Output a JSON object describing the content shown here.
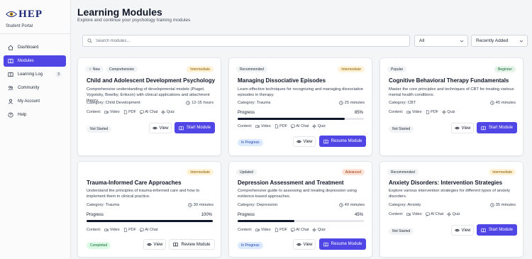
{
  "sidebar": {
    "logo_text": "HEP",
    "portal_label": "Student Portal",
    "items": [
      {
        "label": "Dashboard",
        "icon": "home-icon"
      },
      {
        "label": "Modules",
        "icon": "book-icon",
        "active": true
      },
      {
        "label": "Learning Log",
        "icon": "book-icon",
        "count": "3"
      },
      {
        "label": "Community",
        "icon": "users-icon"
      },
      {
        "label": "My Account",
        "icon": "user-icon"
      },
      {
        "label": "Help",
        "icon": "help-icon"
      }
    ]
  },
  "header": {
    "title": "Learning Modules",
    "subtitle": "Explore and continue your psychology training modules"
  },
  "filters": {
    "search_placeholder": "Search modules...",
    "level_select": "All",
    "sort_select": "Recently Added"
  },
  "colors": {
    "accent": "#4f46e5",
    "progress": "#0f172a"
  },
  "cards": [
    {
      "tags": [
        "New",
        "Comprehensive"
      ],
      "level": "Intermediate",
      "title": "Child and Adolescent Development Psychology",
      "desc": "Comprehensive understanding of developmental models (Piaget, Vygotsky, Bowlby, Erikson) with clinical applications and attachment theory.",
      "category": "Category: Child Development",
      "duration": "12-15 hours",
      "content_label": "Content:",
      "content": [
        "Video",
        "PDF",
        "AI Chat",
        "Quiz"
      ],
      "status": "Not Started",
      "view": "View",
      "action": "Start Module"
    },
    {
      "tags": [
        "Recommended"
      ],
      "level": "Intermediate",
      "title": "Managing Dissociative Episodes",
      "desc": "Learn effective techniques for recognizing and managing dissociative episodes in therapy.",
      "category": "Category: Trauma",
      "duration": "25 minutes",
      "progress_label": "Progress",
      "progress_value": "85%",
      "progress": 0.85,
      "content_label": "Content:",
      "content": [
        "Video",
        "PDF",
        "AI Chat",
        "Quiz"
      ],
      "status": "In Progress",
      "view": "View",
      "action": "Resume Module"
    },
    {
      "tags": [
        "Popular"
      ],
      "level": "Beginner",
      "title": "Cognitive Behavioral Therapy Fundamentals",
      "desc": "Master the core principles and techniques of CBT for treating various mental health conditions.",
      "category": "Category: CBT",
      "duration": "45 minutes",
      "content_label": "Content:",
      "content": [
        "Video",
        "PDF",
        "Quiz"
      ],
      "status": "Not Started",
      "view": "View",
      "action": "Start Module"
    },
    {
      "tags": [],
      "level": "Intermediate",
      "title": "Trauma-Informed Care Approaches",
      "desc": "Understand the principles of trauma-informed care and how to implement them in clinical practice.",
      "category": "Category: Trauma",
      "duration": "30 minutes",
      "progress_label": "Progress",
      "progress_value": "100%",
      "progress": 1.0,
      "content_label": "Content:",
      "content": [
        "Video",
        "PDF",
        "AI Chat"
      ],
      "status": "Completed",
      "view": "View",
      "action": "Review Module"
    },
    {
      "tags": [
        "Updated"
      ],
      "level": "Advanced",
      "title": "Depression Assessment and Treatment",
      "desc": "Comprehensive guide to assessing and treating depression using evidence-based approaches.",
      "category": "Category: Depression",
      "duration": "40 minutes",
      "progress_label": "Progress",
      "progress_value": "45%",
      "progress": 0.45,
      "content_label": "Content:",
      "content": [
        "Video",
        "PDF",
        "AI Chat",
        "Quiz"
      ],
      "status": "In Progress",
      "view": "View",
      "action": "Resume Module"
    },
    {
      "tags": [
        "Recommended"
      ],
      "level": "Intermediate",
      "title": "Anxiety Disorders: Intervention Strategies",
      "desc": "Explore various intervention strategies for different types of anxiety disorders.",
      "category": "Category: Anxiety",
      "duration": "35 minutes",
      "content_label": "Content:",
      "content": [
        "Video",
        "AI Chat",
        "Quiz"
      ],
      "status": "Not Started",
      "view": "View",
      "action": "Start Module"
    }
  ]
}
